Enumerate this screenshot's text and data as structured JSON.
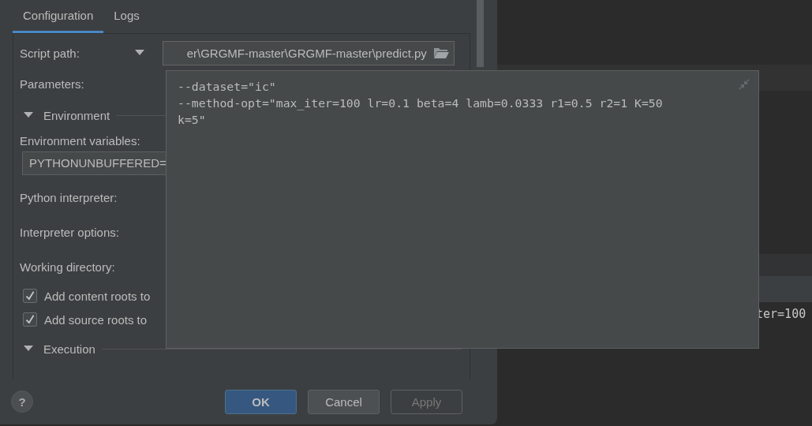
{
  "tabs": [
    {
      "label": "Configuration",
      "selected": true
    },
    {
      "label": "Logs",
      "selected": false
    }
  ],
  "rows": [
    {
      "kind": "path",
      "label": "Script path:",
      "value": "er\\GRGMF-master\\GRGMF-master\\predict.py"
    },
    {
      "kind": "label",
      "label": "Parameters:"
    },
    {
      "kind": "section",
      "label": "Environment",
      "expanded": true
    },
    {
      "kind": "caption",
      "label": "Environment variables:"
    },
    {
      "kind": "input",
      "value": "PYTHONUNBUFFERED="
    },
    {
      "kind": "label",
      "label": "Python interpreter:"
    },
    {
      "kind": "label",
      "label": "Interpreter options:"
    },
    {
      "kind": "label",
      "label": "Working directory:"
    },
    {
      "kind": "checkbox",
      "label": "Add content roots to",
      "checked": true
    },
    {
      "kind": "checkbox",
      "label": "Add source roots to",
      "checked": true
    },
    {
      "kind": "section",
      "label": "Execution",
      "expanded": true
    }
  ],
  "buttons": [
    {
      "label": "OK",
      "default": true,
      "disabled": false
    },
    {
      "label": "Cancel",
      "default": false,
      "disabled": false
    },
    {
      "label": "Apply",
      "default": false,
      "disabled": true
    }
  ],
  "help": {
    "label": "?"
  },
  "popup": {
    "lines": [
      "--dataset=\"ic\"",
      "--method-opt=\"max_iter=100 lr=0.1 beta=4 lamb=0.0333 r1=0.5 r2=1 K=50",
      "k=5\""
    ]
  },
  "editor": {
    "text": "ter=100"
  }
}
